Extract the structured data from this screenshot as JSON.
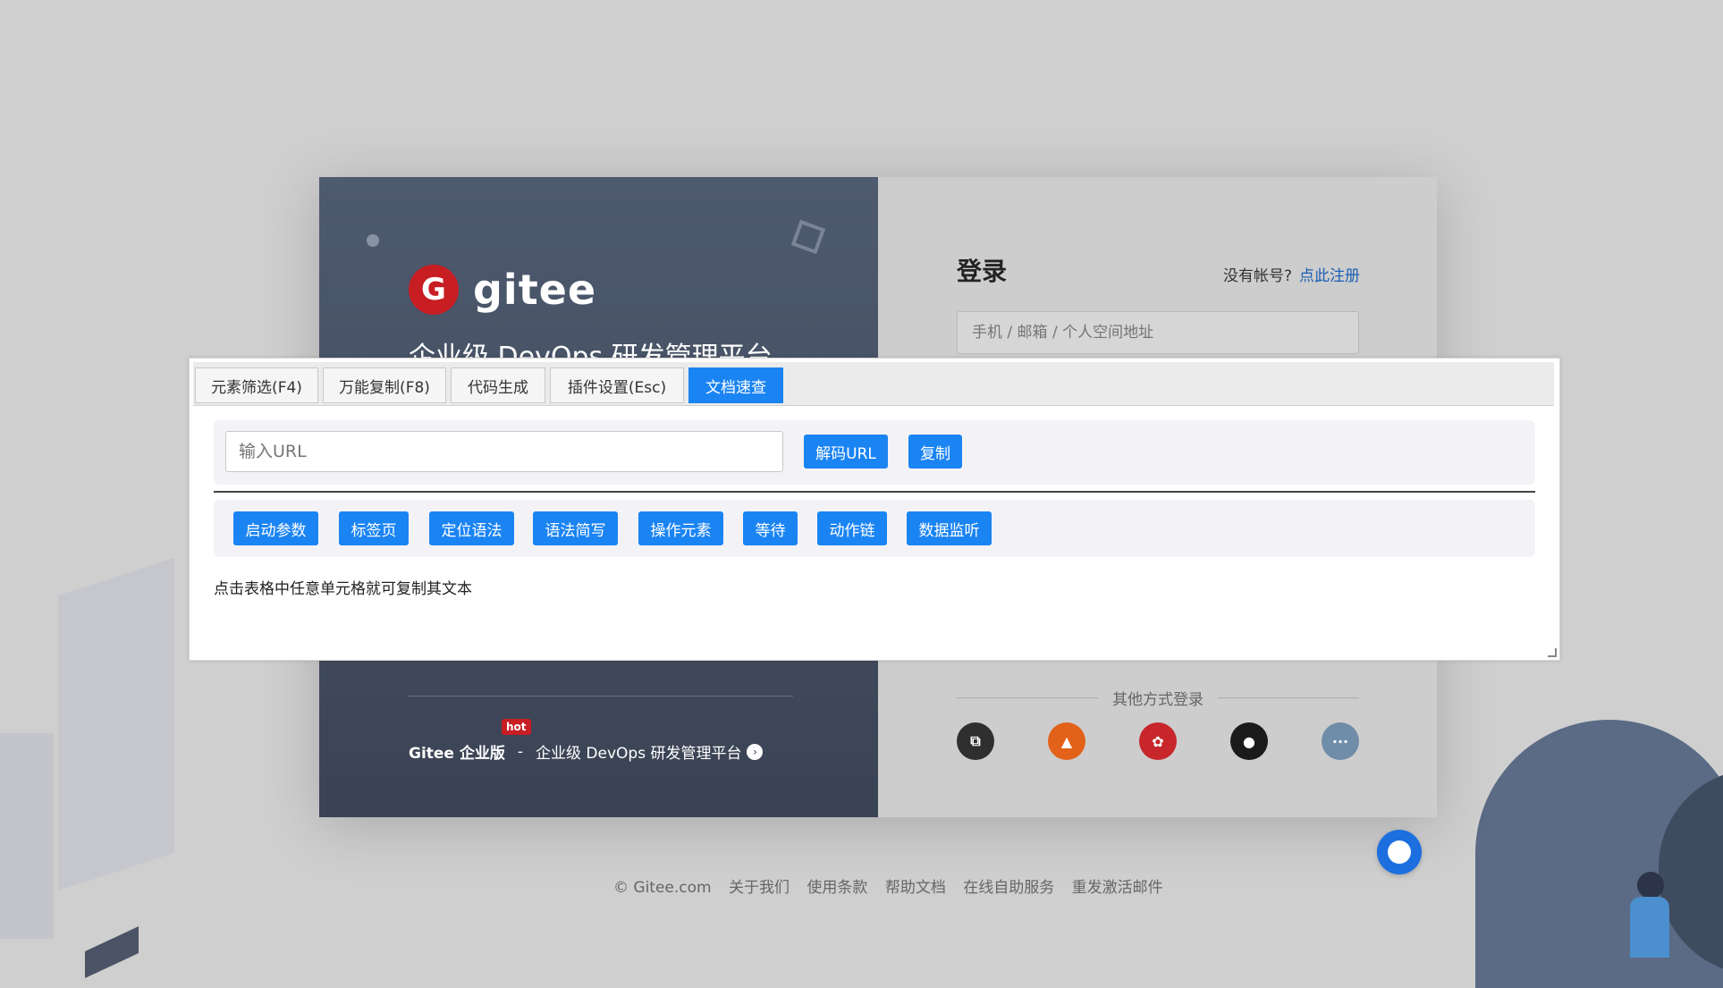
{
  "login_page": {
    "logo_text": "gitee",
    "slogan": "企业级 DevOps 研发管理平台",
    "login_title": "登录",
    "no_account": "没有帐号?",
    "register_link": "点此注册",
    "account_placeholder": "手机 / 邮箱 / 个人空间地址",
    "other_login": "其他方式登录",
    "enterprise_brand": "Gitee 企业版",
    "hot_badge": "hot",
    "enterprise_dash": "-",
    "enterprise_desc": "企业级 DevOps 研发管理平台",
    "social_icons": [
      "code-ide-icon",
      "gitlab-icon",
      "huawei-icon",
      "github-icon",
      "more-icon"
    ],
    "colors": {
      "brand": "#c71d23",
      "gitlab": "#e2621a",
      "huawei": "#c7262a",
      "more": "#6f8ca8",
      "link": "#1a5fb4"
    }
  },
  "footer": {
    "copyright": "© Gitee.com",
    "about": "关于我们",
    "terms": "使用条款",
    "help": "帮助文档",
    "self_service": "在线自助服务",
    "resend": "重发激活邮件"
  },
  "panel": {
    "tabs": [
      {
        "label": "元素筛选(F4)",
        "active": false
      },
      {
        "label": "万能复制(F8)",
        "active": false
      },
      {
        "label": "代码生成",
        "active": false
      },
      {
        "label": "插件设置(Esc)",
        "active": false
      },
      {
        "label": "文档速查",
        "active": true
      }
    ],
    "url_placeholder": "输入URL",
    "decode_button": "解码URL",
    "copy_button": "复制",
    "doc_buttons": [
      "启动参数",
      "标签页",
      "定位语法",
      "语法简写",
      "操作元素",
      "等待",
      "动作链",
      "数据监听"
    ],
    "hint": "点击表格中任意单元格就可复制其文本",
    "accent": "#1b84f3"
  }
}
